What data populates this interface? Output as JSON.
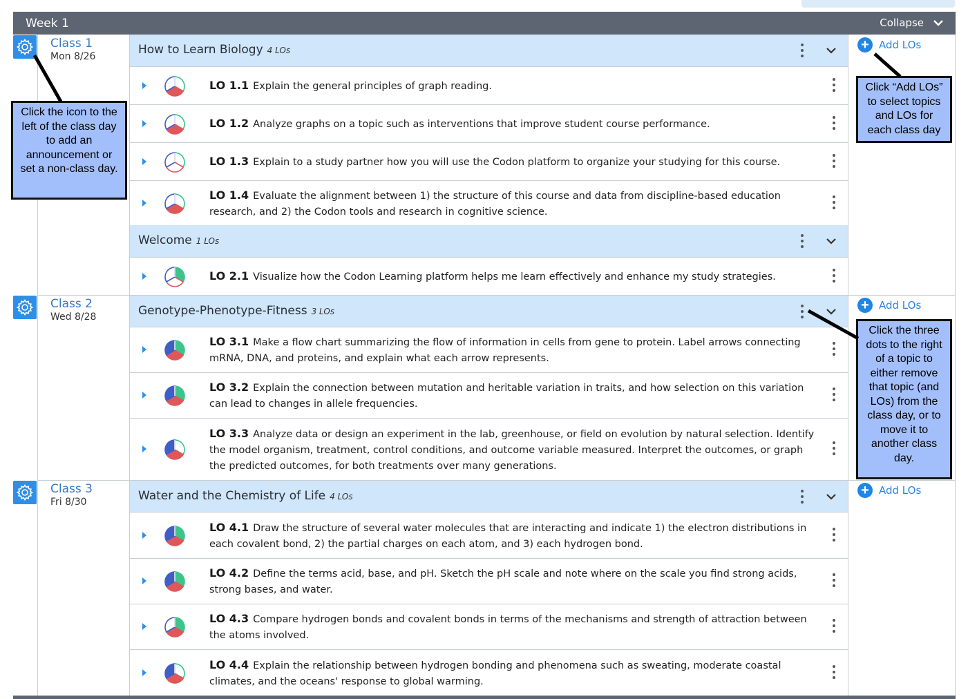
{
  "week": {
    "title": "Week 1",
    "collapse_label": "Collapse"
  },
  "add_los_label": "Add LOs",
  "classes": [
    {
      "name": "Class 1",
      "date": "Mon 8/26",
      "topics": [
        {
          "title": "How to Learn Biology",
          "count": "4 LOs",
          "los": [
            {
              "id": "LO 1.1",
              "text": "Explain the general principles of graph reading."
            },
            {
              "id": "LO 1.2",
              "text": "Analyze graphs on a topic such as interventions that improve student course performance."
            },
            {
              "id": "LO 1.3",
              "text": "Explain to a study partner how you will use the Codon platform to organize your studying for this course."
            },
            {
              "id": "LO 1.4",
              "text": "Evaluate the alignment between 1) the structure of this course and data from discipline-based education research, and 2) the Codon tools and research in cognitive science."
            }
          ]
        },
        {
          "title": "Welcome",
          "count": "1 LOs",
          "los": [
            {
              "id": "LO 2.1",
              "text": "Visualize how the Codon Learning platform helps me learn effectively and enhance my study strategies."
            }
          ]
        }
      ]
    },
    {
      "name": "Class 2",
      "date": "Wed 8/28",
      "topics": [
        {
          "title": "Genotype-Phenotype-Fitness",
          "count": "3 LOs",
          "los": [
            {
              "id": "LO 3.1",
              "text": "Make a flow chart summarizing the flow of information in cells from gene to protein. Label arrows connecting mRNA, DNA, and proteins, and explain what each arrow represents."
            },
            {
              "id": "LO 3.2",
              "text": "Explain the connection between mutation and heritable variation in traits, and how selection on this variation can lead to changes in allele frequencies."
            },
            {
              "id": "LO 3.3",
              "text": "Analyze data or design an experiment in the lab, greenhouse, or field on evolution by natural selection. Identify the model organism, treatment, control conditions, and outcome variable measured. Interpret the outcomes, or graph the predicted outcomes, for both treatments over many generations."
            }
          ]
        }
      ]
    },
    {
      "name": "Class 3",
      "date": "Fri 8/30",
      "topics": [
        {
          "title": "Water and the Chemistry of Life",
          "count": "4 LOs",
          "los": [
            {
              "id": "LO 4.1",
              "text": "Draw the structure of several water molecules that are interacting and indicate 1) the electron distributions in each covalent bond, 2) the partial charges on each atom, and 3) each hydrogen bond."
            },
            {
              "id": "LO 4.2",
              "text": "Define the terms acid, base, and pH. Sketch the pH scale and note where on the scale you find strong acids, strong bases, and water."
            },
            {
              "id": "LO 4.3",
              "text": "Compare hydrogen bonds and covalent bonds in terms of the mechanisms and strength of attraction between the atoms involved."
            },
            {
              "id": "LO 4.4",
              "text": "Explain the relationship between hydrogen bonding and phenomena such as sweating, moderate coastal climates, and the oceans' response to global warming."
            }
          ]
        }
      ]
    }
  ],
  "callouts": {
    "gear": "Click the icon to the left of the class day to add an announcement or set a non-class day.",
    "add_los": "Click “Add LOs” to select topics and LOs for each class day",
    "dots": "Click the three dots to the right of a topic to either remove that topic (and LOs) from the class day, or to move it to another class day."
  },
  "colors": {
    "header": "#5c6571",
    "topic_bg": "#cfe6fb",
    "accent": "#2f8fe6",
    "pie_blue": "#3f5fc7",
    "pie_green": "#3cc48a",
    "pie_red": "#e0575a",
    "callout_bg": "#a3bffb"
  },
  "icons": {
    "gear": "gear-icon",
    "add": "plus-circle-icon",
    "menu": "kebab-icon",
    "chevron": "chevron-down-icon",
    "expand": "caret-right-icon",
    "pie": "mastery-pie-icon"
  }
}
